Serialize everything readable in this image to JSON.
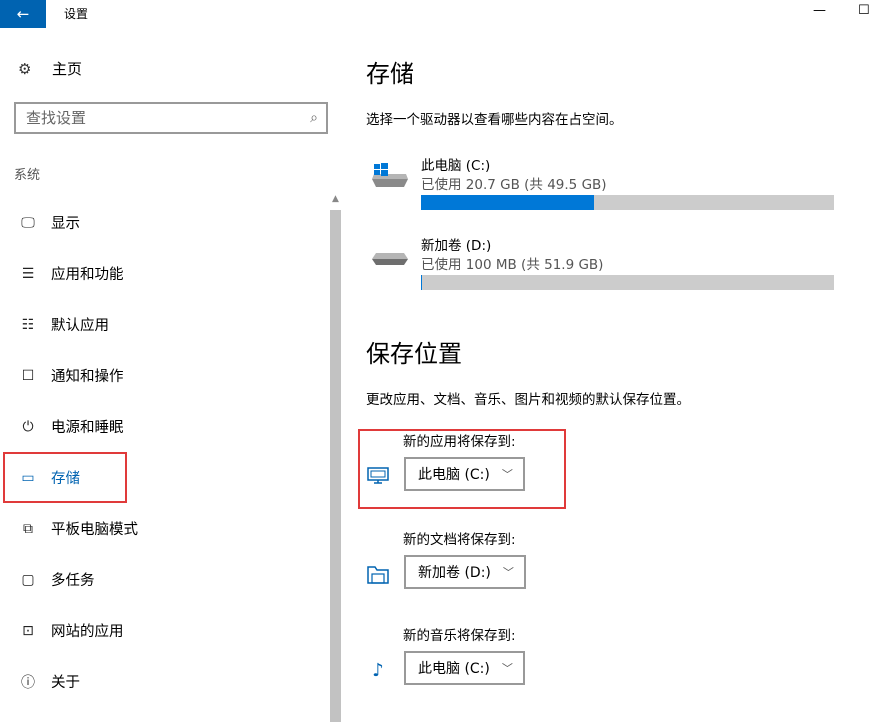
{
  "window": {
    "title": "设置",
    "back_glyph": "←",
    "minimize_glyph": "—",
    "maximize_glyph": "☐"
  },
  "sidebar": {
    "home_label": "主页",
    "search_placeholder": "查找设置",
    "section_label": "系统",
    "items": [
      {
        "label": "显示",
        "icon": "monitor-icon",
        "glyph": "🖵"
      },
      {
        "label": "应用和功能",
        "icon": "apps-list-icon",
        "glyph": "☰"
      },
      {
        "label": "默认应用",
        "icon": "default-apps-icon",
        "glyph": "☷"
      },
      {
        "label": "通知和操作",
        "icon": "notification-icon",
        "glyph": "☐"
      },
      {
        "label": "电源和睡眠",
        "icon": "power-icon",
        "glyph": "⏻"
      },
      {
        "label": "存储",
        "icon": "storage-icon",
        "glyph": "▭",
        "active": true
      },
      {
        "label": "平板电脑模式",
        "icon": "tablet-mode-icon",
        "glyph": "⧉"
      },
      {
        "label": "多任务",
        "icon": "multitask-icon",
        "glyph": "▢"
      },
      {
        "label": "网站的应用",
        "icon": "web-apps-icon",
        "glyph": "⊡"
      },
      {
        "label": "关于",
        "icon": "info-icon",
        "glyph": "ⓘ"
      }
    ]
  },
  "main": {
    "title": "存储",
    "description": "选择一个驱动器以查看哪些内容在占空间。",
    "drives": [
      {
        "name": "此电脑 (C:)",
        "usage": "已使用 20.7 GB (共 49.5 GB)",
        "used_fraction": 0.418,
        "icon": "windows-drive-icon"
      },
      {
        "name": "新加卷 (D:)",
        "usage": "已使用 100 MB (共 51.9 GB)",
        "used_fraction": 0.002,
        "icon": "drive-icon"
      }
    ],
    "save_section_title": "保存位置",
    "save_description": "更改应用、文档、音乐、图片和视频的默认保存位置。",
    "save_locations": [
      {
        "label": "新的应用将保存到:",
        "value": "此电脑 (C:)",
        "icon": "keyboard-monitor-icon"
      },
      {
        "label": "新的文档将保存到:",
        "value": "新加卷 (D:)",
        "icon": "folder-icon"
      },
      {
        "label": "新的音乐将保存到:",
        "value": "此电脑 (C:)",
        "icon": "music-note-icon"
      }
    ]
  },
  "colors": {
    "accent": "#0063b1",
    "bar_fill": "#0078d7",
    "bar_track": "#cccccc",
    "highlight": "#e03a3a"
  }
}
